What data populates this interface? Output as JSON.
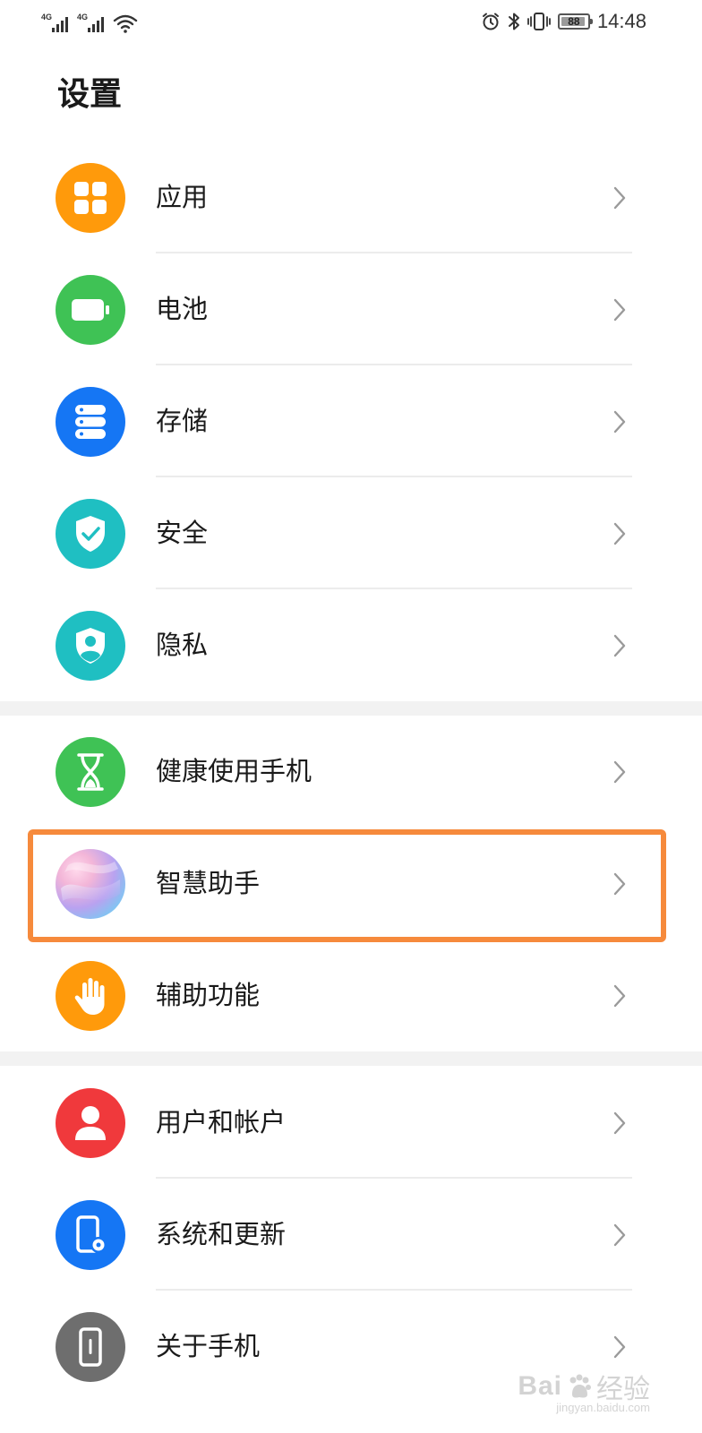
{
  "status_bar": {
    "sim1_tag": "4G",
    "sim2_tag": "4G",
    "battery_percent": "88",
    "time": "14:48"
  },
  "page": {
    "title": "设置"
  },
  "sections": [
    {
      "items": [
        {
          "label": "应用",
          "icon": "apps-grid-icon",
          "color": "#FF9A0B"
        },
        {
          "label": "电池",
          "icon": "battery-icon",
          "color": "#3FC255"
        },
        {
          "label": "存储",
          "icon": "storage-icon",
          "color": "#1576F4"
        },
        {
          "label": "安全",
          "icon": "shield-check-icon",
          "color": "#1FBFC2"
        },
        {
          "label": "隐私",
          "icon": "privacy-shield-icon",
          "color": "#1FBFC2"
        }
      ]
    },
    {
      "items": [
        {
          "label": "健康使用手机",
          "icon": "hourglass-icon",
          "color": "#3FC255"
        },
        {
          "label": "智慧助手",
          "icon": "assistant-orb-icon",
          "color": "#C8A8F0"
        },
        {
          "label": "辅助功能",
          "icon": "hand-icon",
          "color": "#FF9A0B"
        }
      ]
    },
    {
      "items": [
        {
          "label": "用户和帐户",
          "icon": "user-icon",
          "color": "#F0393C"
        },
        {
          "label": "系统和更新",
          "icon": "phone-settings-icon",
          "color": "#1576F4"
        },
        {
          "label": "关于手机",
          "icon": "phone-info-icon",
          "color": "#6E6E6E"
        }
      ]
    }
  ],
  "highlight_color": "#F68A3C",
  "watermark": {
    "brand": "Bai",
    "sub": "经验",
    "url": "jingyan.baidu.com"
  }
}
